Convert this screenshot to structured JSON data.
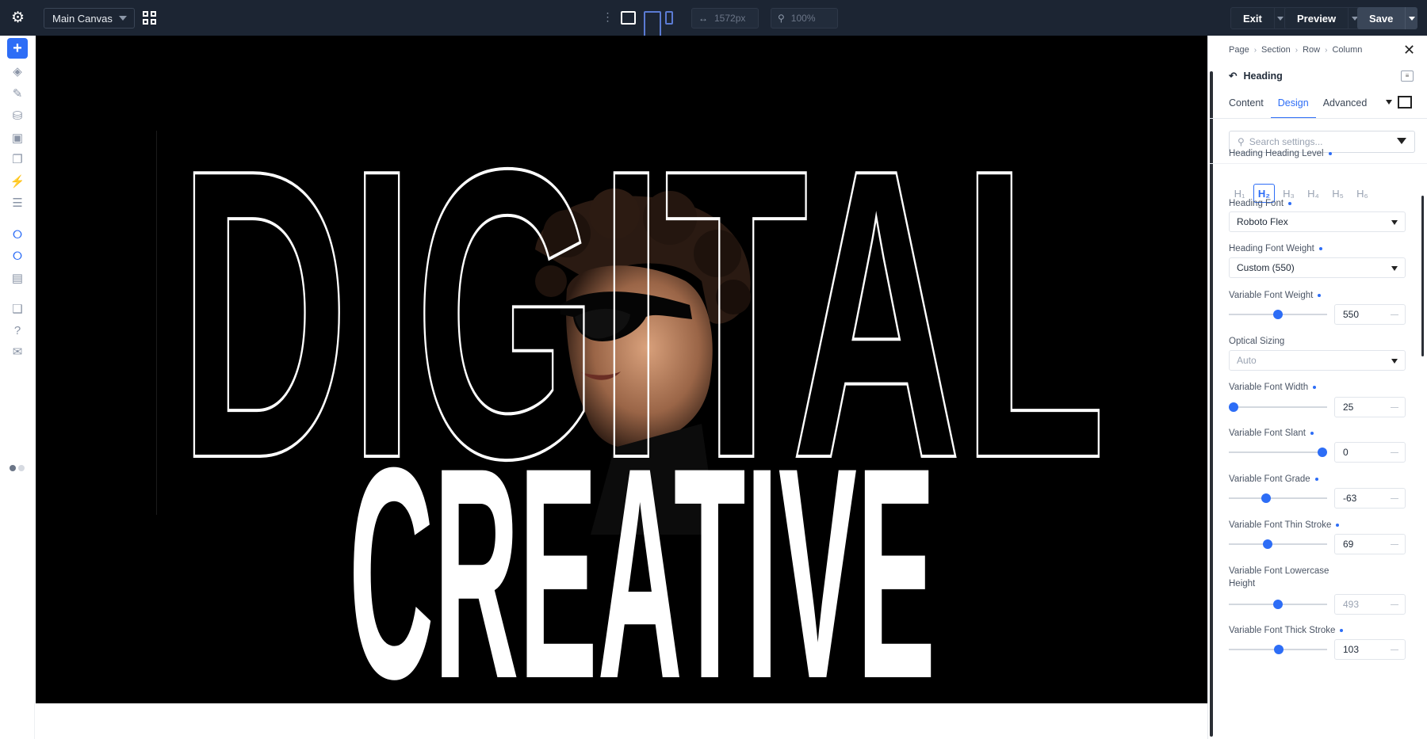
{
  "topbar": {
    "canvas_select": "Main Canvas",
    "width_value": "1572px",
    "zoom_value": "100%",
    "exit_label": "Exit",
    "preview_label": "Preview",
    "save_label": "Save"
  },
  "canvas": {
    "headline_outline": "DIGITAL",
    "headline_solid": "CREATIVE"
  },
  "panel": {
    "breadcrumbs": [
      "Page",
      "Section",
      "Row",
      "Column"
    ],
    "module_title": "Heading",
    "tabs": [
      "Content",
      "Design",
      "Advanced"
    ],
    "active_tab": "Design",
    "search_placeholder": "Search settings...",
    "heading_level": {
      "label": "Heading Heading Level",
      "levels": [
        "H₁",
        "H₂",
        "H₃",
        "H₄",
        "H₅",
        "H₆"
      ],
      "selected": "H₂"
    },
    "heading_font": {
      "label": "Heading Font",
      "value": "Roboto Flex"
    },
    "heading_font_weight": {
      "label": "Heading Font Weight",
      "value": "Custom (550)"
    },
    "variable_font_weight": {
      "label": "Variable Font Weight",
      "value": "550",
      "fraction": 0.5
    },
    "optical_sizing": {
      "label": "Optical Sizing",
      "value": "Auto"
    },
    "variable_font_width": {
      "label": "Variable Font Width",
      "value": "25",
      "fraction": 0.0
    },
    "variable_font_slant": {
      "label": "Variable Font Slant",
      "value": "0",
      "fraction": 1.0
    },
    "variable_font_grade": {
      "label": "Variable Font Grade",
      "value": "-63",
      "fraction": 0.37
    },
    "variable_font_thin_stroke": {
      "label": "Variable Font Thin Stroke",
      "value": "69",
      "fraction": 0.38
    },
    "variable_font_lowercase_height": {
      "label_line1": "Variable Font Lowercase",
      "label_line2": "Height",
      "value": "493",
      "fraction": 0.5
    },
    "variable_font_thick_stroke": {
      "label": "Variable Font Thick Stroke",
      "value": "103",
      "fraction": 0.51
    }
  },
  "colors": {
    "topbar_bg": "#1c2533",
    "accent": "#2d6df6",
    "stage_bg": "#000000"
  }
}
